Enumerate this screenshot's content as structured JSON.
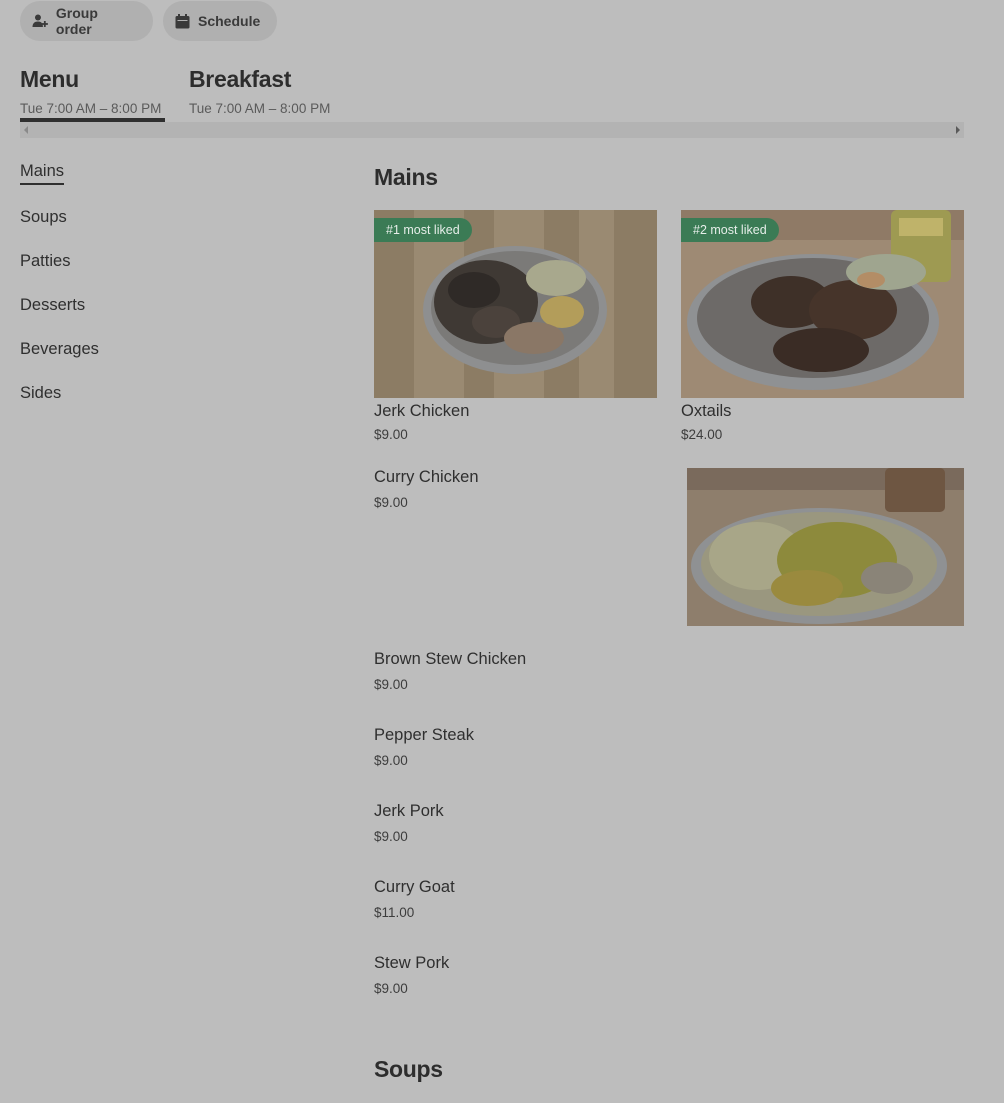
{
  "header": {
    "group_order_label": "Group order",
    "schedule_label": "Schedule"
  },
  "menus": [
    {
      "title": "Menu",
      "hours": "Tue 7:00 AM – 8:00 PM",
      "active": true
    },
    {
      "title": "Breakfast",
      "hours": "Tue 7:00 AM – 8:00 PM",
      "active": false
    }
  ],
  "sidebar": {
    "items": [
      {
        "label": "Mains",
        "active": true
      },
      {
        "label": "Soups"
      },
      {
        "label": "Patties"
      },
      {
        "label": "Desserts"
      },
      {
        "label": "Beverages"
      },
      {
        "label": "Sides"
      }
    ]
  },
  "sections": {
    "mains_title": "Mains",
    "soups_title": "Soups"
  },
  "featured": [
    {
      "name": "Jerk Chicken",
      "price": "$9.00",
      "badge": "#1 most liked",
      "image_icon": "jerk-chicken-photo"
    },
    {
      "name": "Oxtails",
      "price": "$24.00",
      "badge": "#2 most liked",
      "image_icon": "oxtails-photo"
    }
  ],
  "items": [
    {
      "name": "Curry Chicken",
      "price": "$9.00",
      "image_icon": "curry-chicken-photo"
    },
    {
      "name": "Brown Stew Chicken",
      "price": "$9.00"
    },
    {
      "name": "Pepper Steak",
      "price": "$9.00"
    },
    {
      "name": "Jerk Pork",
      "price": "$9.00"
    },
    {
      "name": "Curry Goat",
      "price": "$11.00"
    },
    {
      "name": "Stew Pork",
      "price": "$9.00"
    }
  ],
  "colors": {
    "overlay_background": "#bdbdbd",
    "badge": "#3b7b55",
    "text": "#2f2f2f"
  }
}
